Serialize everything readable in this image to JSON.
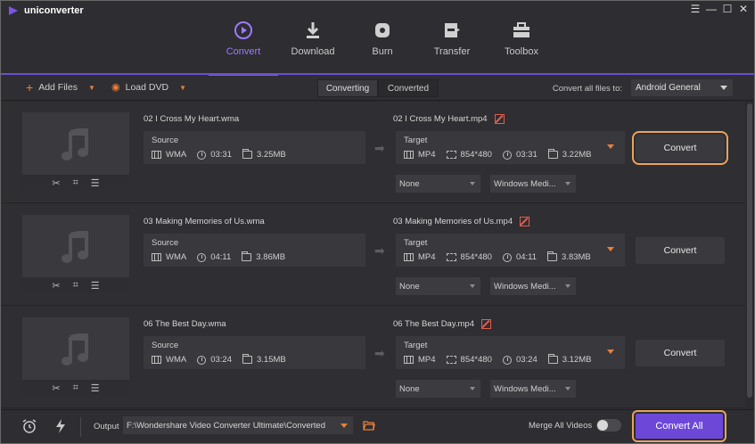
{
  "app": {
    "title": "uniconverter"
  },
  "window_controls": {
    "menu": "☰",
    "minimize": "—",
    "maximize": "☐",
    "close": "✕"
  },
  "nav": {
    "items": [
      {
        "label": "Convert",
        "icon": "convert-icon",
        "active": true
      },
      {
        "label": "Download",
        "icon": "download-icon",
        "active": false
      },
      {
        "label": "Burn",
        "icon": "burn-icon",
        "active": false
      },
      {
        "label": "Transfer",
        "icon": "transfer-icon",
        "active": false
      },
      {
        "label": "Toolbox",
        "icon": "toolbox-icon",
        "active": false
      }
    ]
  },
  "toolbar": {
    "add_files": "Add Files",
    "load_dvd": "Load DVD",
    "tabs": [
      {
        "label": "Converting",
        "active": true
      },
      {
        "label": "Converted",
        "active": false
      }
    ],
    "convert_all_to_label": "Convert all files to:",
    "convert_all_to_value": "Android General"
  },
  "files": [
    {
      "source_name": "02 I Cross My Heart.wma",
      "target_name": "02 I Cross My Heart.mp4",
      "source": {
        "label": "Source",
        "format": "WMA",
        "duration": "03:31",
        "size": "3.25MB"
      },
      "target": {
        "label": "Target",
        "format": "MP4",
        "resolution": "854*480",
        "duration": "03:31",
        "size": "3.22MB"
      },
      "subtitle": "None",
      "audio": "Windows Medi...",
      "convert_label": "Convert",
      "highlighted": true
    },
    {
      "source_name": "03 Making Memories of Us.wma",
      "target_name": "03 Making Memories of Us.mp4",
      "source": {
        "label": "Source",
        "format": "WMA",
        "duration": "04:11",
        "size": "3.86MB"
      },
      "target": {
        "label": "Target",
        "format": "MP4",
        "resolution": "854*480",
        "duration": "04:11",
        "size": "3.83MB"
      },
      "subtitle": "None",
      "audio": "Windows Medi...",
      "convert_label": "Convert",
      "highlighted": false
    },
    {
      "source_name": "06 The Best Day.wma",
      "target_name": "06 The Best Day.mp4",
      "source": {
        "label": "Source",
        "format": "WMA",
        "duration": "03:24",
        "size": "3.15MB"
      },
      "target": {
        "label": "Target",
        "format": "MP4",
        "resolution": "854*480",
        "duration": "03:24",
        "size": "3.12MB"
      },
      "subtitle": "None",
      "audio": "Windows Medi...",
      "convert_label": "Convert",
      "highlighted": false
    }
  ],
  "bottom": {
    "output_label": "Output",
    "output_path": "F:\\Wondershare Video Converter Ultimate\\Converted",
    "merge_label": "Merge All Videos",
    "merge_on": false,
    "convert_all_label": "Convert All"
  },
  "colors": {
    "accent": "#6d48d8",
    "orange": "#e8803a",
    "highlight": "#e8a45c",
    "edit": "#e05d4f"
  }
}
